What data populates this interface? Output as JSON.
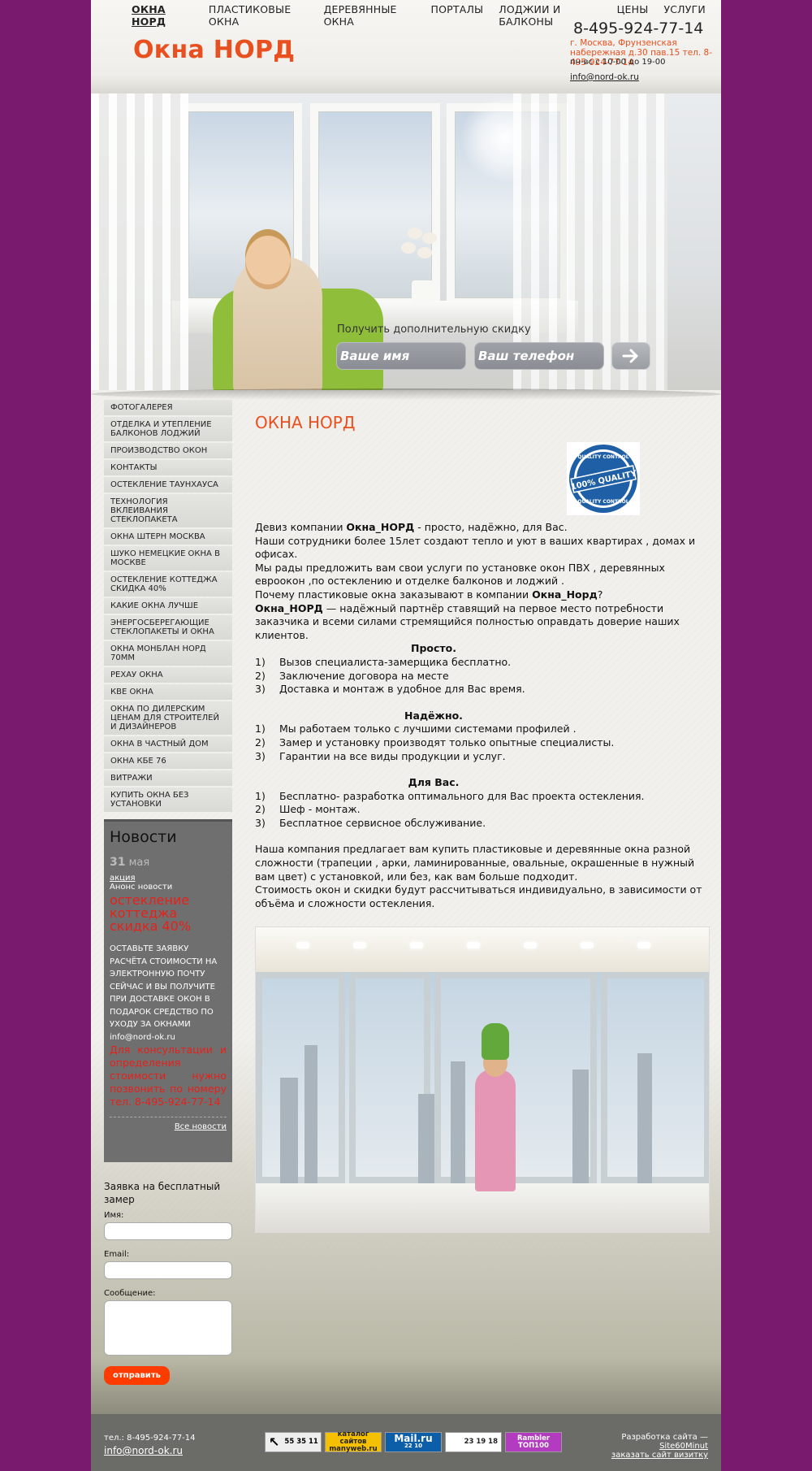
{
  "topnav": [
    "ОКНА НОРД",
    "ПЛАСТИКОВЫЕ ОКНА",
    "ДЕРЕВЯННЫЕ ОКНА",
    "ПОРТАЛЫ",
    "ЛОДЖИИ И БАЛКОНЫ",
    "ЦЕНЫ",
    "УСЛУГИ"
  ],
  "header": {
    "logo": "Окна НОРД",
    "phone": "8-495-924-77-14",
    "address": "г. Москва, Фрунзенская набережная д.30 пав.15   тел. 8-495-924-77-14",
    "hours": "пн-вс с 10-00 до 19-00",
    "email": "info@nord-ok.ru"
  },
  "hero": {
    "caption": "Получить дополнительную скидку",
    "name_placeholder": "Ваше имя",
    "phone_placeholder": "Ваш телефон"
  },
  "sidebar": [
    "ФОТОГАЛЕРЕЯ",
    "ОТДЕЛКА И УТЕПЛЕНИЕ БАЛКОНОВ ЛОДЖИЙ",
    "ПРОИЗВОДСТВО ОКОН",
    "КОНТАКТЫ",
    "ОСТЕКЛЕНИЕ ТАУНХАУСА",
    "ТЕХНОЛОГИЯ ВКЛЕИВАНИЯ СТЕКЛОПАКЕТА",
    "ОКНА ШТЕРН МОСКВА",
    "ШУКО НЕМЕЦКИЕ ОКНА В МОСКВЕ",
    "ОСТЕКЛЕНИЕ КОТТЕДЖА СКИДКА 40%",
    "КАКИЕ ОКНА ЛУЧШЕ",
    "ЭНЕРГОСБЕРЕГАЮЩИЕ СТЕКЛОПАКЕТЫ И ОКНА",
    "ОКНА МОНБЛАН НОРД 70ММ",
    "РЕХАУ ОКНА",
    "КВЕ ОКНА",
    "ОКНА ПО ДИЛЕРСКИМ ЦЕНАМ ДЛЯ СТРОИТЕЛЕЙ И ДИЗАЙНЕРОВ",
    "ОКНА В ЧАСТНЫЙ ДОМ",
    "ОКНА КБЕ 76",
    "ВИТРАЖИ",
    "КУПИТЬ ОКНА БЕЗ УСТАНОВКИ"
  ],
  "news": {
    "title": "Новости",
    "day": "31",
    "month": "мая",
    "tag": "акция",
    "anons": "Анонс новости",
    "headline": "остекление коттеджа скидка 40%",
    "body": "ОСТАВЬТЕ ЗАЯВКУ  РАСЧЁТА СТОИМОСТИ НА ЭЛЕКТРОННУЮ ПОЧТУ СЕЙЧАС И ВЫ ПОЛУЧИТЕ ПРИ ДОСТАВКЕ ОКОН  В ПОДАРОК СРЕДСТВО ПО УХОДУ ЗА ОКНАМИ",
    "email": "info@nord-ok.ru",
    "call": "Для консультации и определения стоимости нужно позвонить    по номеру     тел. 8-495-924-77-14",
    "all_link": "Все новости"
  },
  "request": {
    "title": "Заявка на бесплатный замер",
    "name_label": "Имя:",
    "email_label": "Email:",
    "message_label": "Сообщение:",
    "submit": "отправить"
  },
  "main": {
    "title": "ОКНА НОРД",
    "seal": {
      "top": "QUALITY CONTROL",
      "center": "100% QUALITY",
      "bottom": "QUALITY CONTROL"
    },
    "p1_a": "Девиз компании ",
    "p1_b": "Окна_НОРД",
    "p1_c": " - просто, надёжно, для Вас.",
    "p2": "Наши сотрудники более 15лет создают тепло и уют в ваших квартирах , домах и офисах.",
    "p3": "Мы рады предложить вам свои услуги по установке окон ПВХ , деревянных евроокон ,по остеклению и отделке балконов и лоджий .",
    "p4_a": "Почему пластиковые окна заказывают в компании ",
    "p4_b": "Окна_Норд",
    "p4_c": "?",
    "p5_a": "Окна_НОРД",
    "p5_b": " — надёжный партнёр ставящий на первое место потребности заказчика и всеми силами стремящийся полностью оправдать доверие наших клиентов.",
    "h_simple": "Просто.",
    "simple": [
      "Вызов специалиста-замерщика бесплатно.",
      "Заключение договора на месте",
      "Доставка и монтаж в удобное для Вас время."
    ],
    "h_reliable": "Надёжно.",
    "reliable": [
      "Мы работаем только с лучшими системами профилей .",
      "Замер и установку производят только опытные специалисты.",
      "Гарантии на все виды продукции и услуг."
    ],
    "h_you": "Для Вас.",
    "you": [
      "Бесплатно- разработка оптимального для Вас проекта остекления.",
      "Шеф - монтаж.",
      "Бесплатное сервисное обслуживание."
    ],
    "p6": "Наша компания предлагает вам купить пластиковые и деревянные окна разной сложности (трапеции , арки, ламинированные, овальные, окрашенные в нужный вам цвет) с установкой, или без, как вам больше подходит.",
    "p7": "Стоимость окон и скидки будут рассчитываться индивидуально, в зависимости от объёма и сложности остекления."
  },
  "footer": {
    "phone": "тел.:  8-495-924-77-14",
    "email": "info@nord-ok.ru",
    "badge1": "55 35 11",
    "badge2": "каталог сайтов manyweb.ru",
    "badge3": "Mail.ru",
    "badge3_sub": "22  10",
    "badge4": "23 19 18",
    "badge5": "Rambler ТОП100",
    "dev_prefix": "Разработка сайта — ",
    "dev_link": "Site60Minut",
    "order_link": "заказать сайт визитку"
  },
  "colors": {
    "background": "#7a1a6e",
    "accent": "#e8501f",
    "news_red": "#e8201a",
    "button": "#ff3c00"
  }
}
